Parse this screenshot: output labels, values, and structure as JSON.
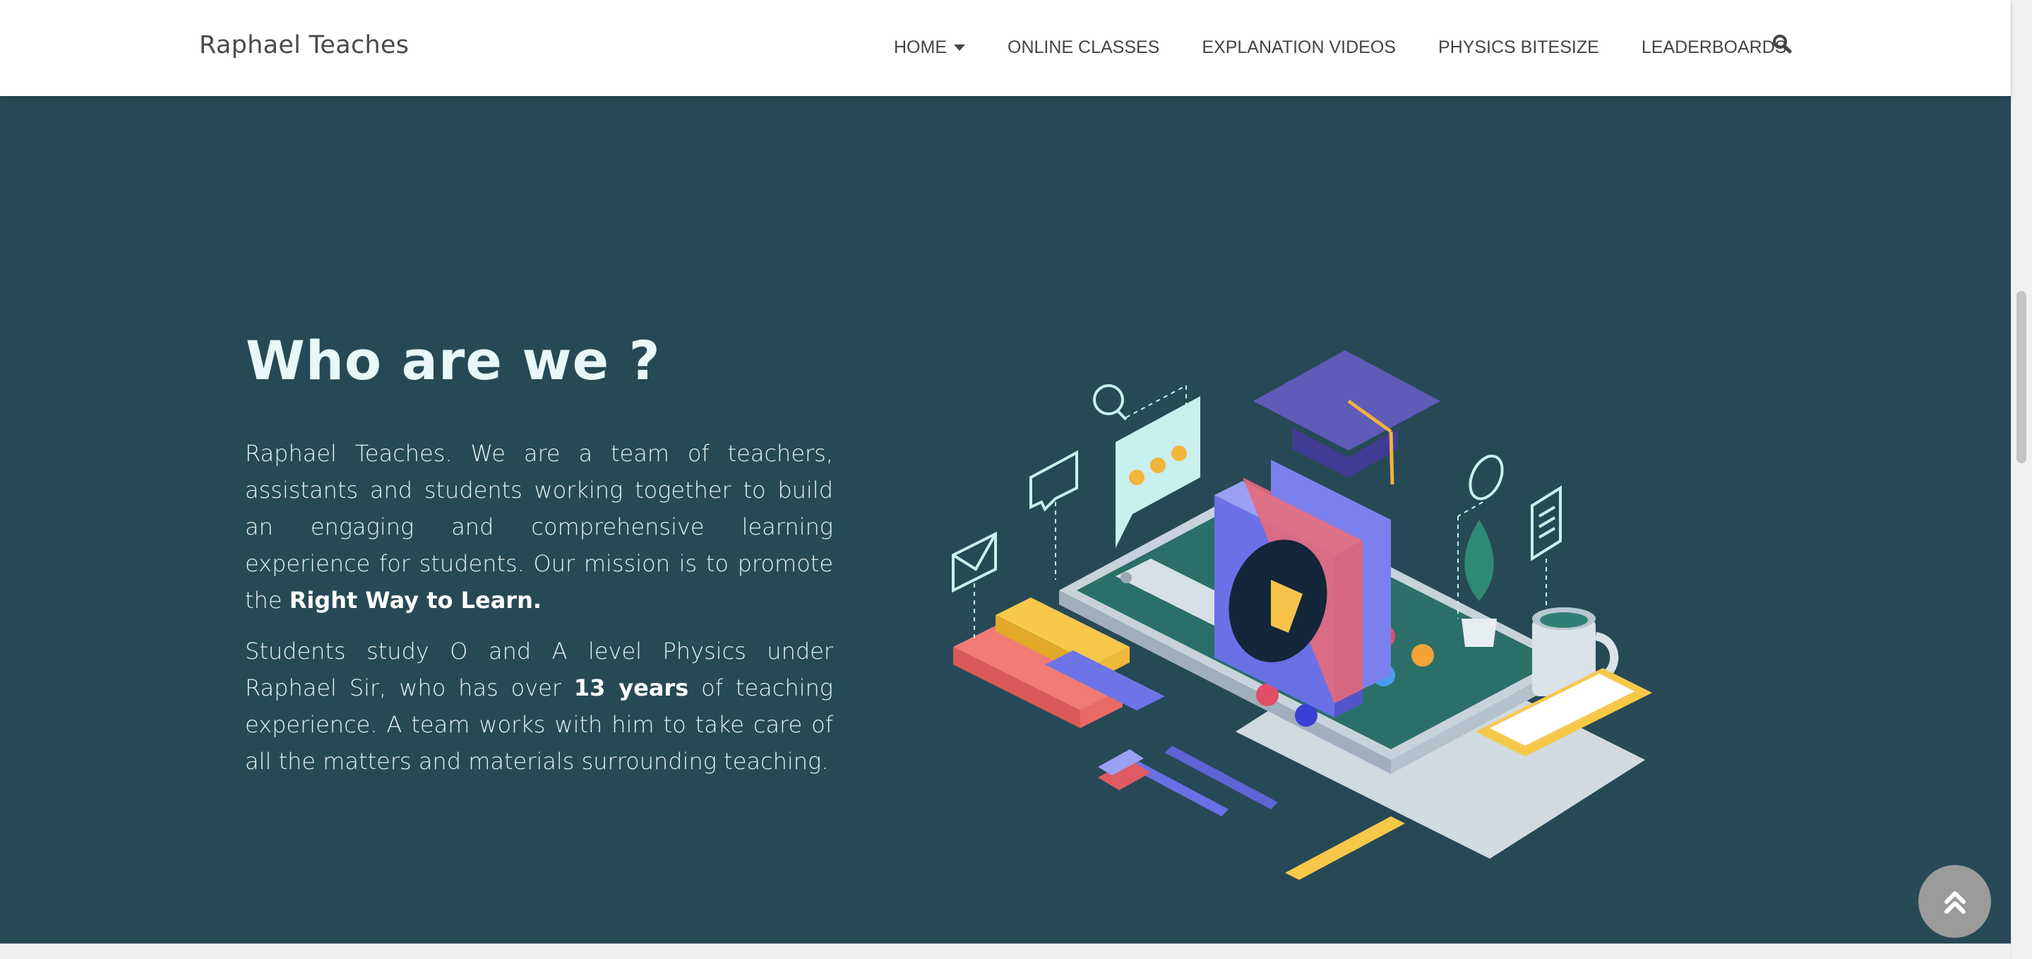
{
  "brand": {
    "name": "Raphael Teaches"
  },
  "nav": {
    "items": [
      {
        "label": "HOME",
        "has_dropdown": true
      },
      {
        "label": "ONLINE CLASSES"
      },
      {
        "label": "EXPLANATION VIDEOS"
      },
      {
        "label": "PHYSICS BITESIZE"
      },
      {
        "label": "LEADERBOARDS"
      }
    ],
    "search_icon": "search-icon"
  },
  "hero": {
    "title": "Who are we ?",
    "p1_a": "Raphael Teaches. We are a team of teachers, assistants and students working together to build an engaging and comprehensive learning experience for students. Our mission is to promote the ",
    "p1_bold": "Right Way to Learn.",
    "p2_a": "Students study O and A level Physics under Raphael Sir, who has over ",
    "p2_bold": "13 years",
    "p2_b": " of teaching experience. A team works with him to take care of all the matters and materials surrounding teaching."
  },
  "back_to_top": {
    "icon": "double-chevron-up-icon"
  },
  "colors": {
    "hero_bg": "#274956",
    "nav_bg": "#ffffff",
    "title": "#e8f7f7",
    "button": "#9b9b9b"
  }
}
